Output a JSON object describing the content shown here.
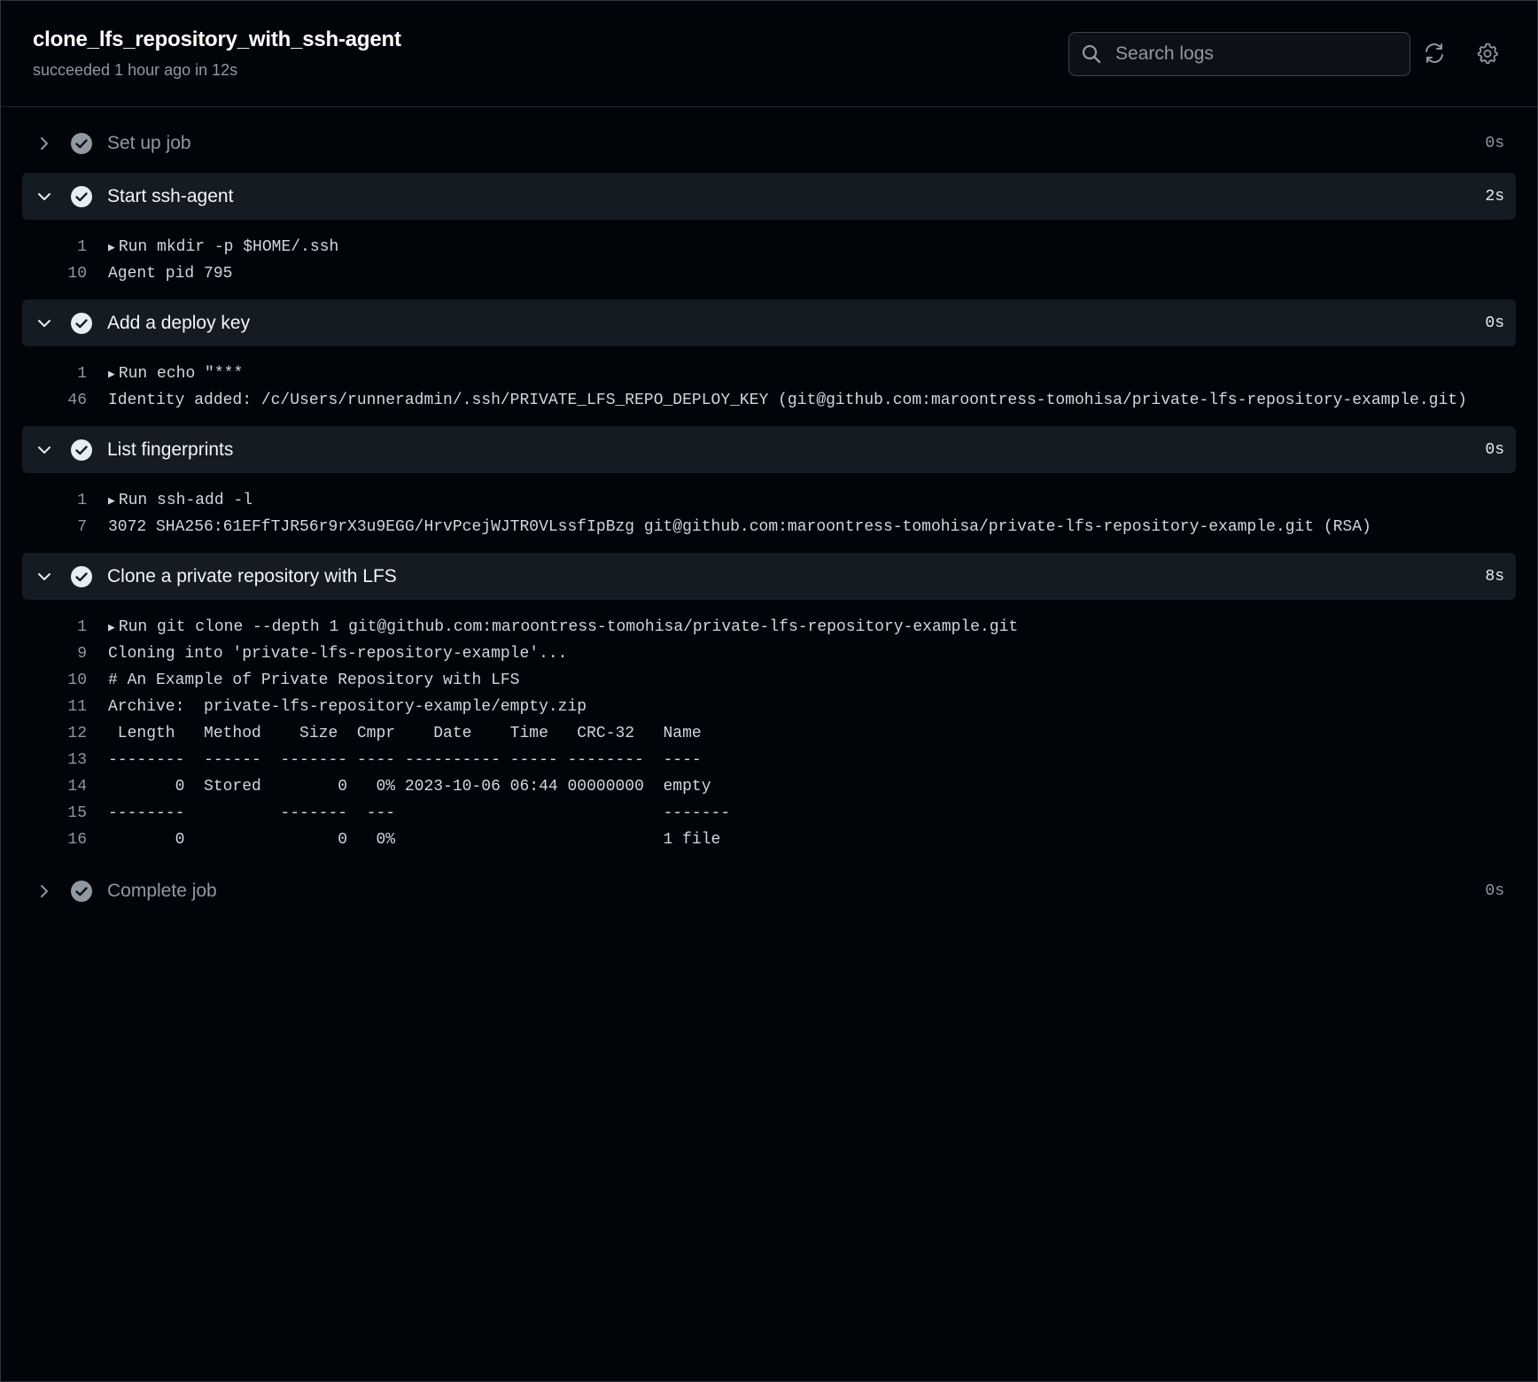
{
  "header": {
    "title": "clone_lfs_repository_with_ssh-agent",
    "status": "succeeded 1 hour ago in 12s",
    "search_placeholder": "Search logs",
    "refresh_icon": "sync-icon",
    "settings_icon": "gear-icon"
  },
  "colors": {
    "background": "#010409",
    "expanded_header": "#151b23",
    "muted_text": "#9198a1",
    "check_bg": "#9198a1"
  },
  "steps": [
    {
      "name": "Set up job",
      "duration": "0s",
      "expanded": false
    },
    {
      "name": "Start ssh-agent",
      "duration": "2s",
      "expanded": true,
      "lines": [
        {
          "num": "1",
          "text": "Run mkdir -p $HOME/.ssh",
          "collapsible": true
        },
        {
          "num": "10",
          "text": "Agent pid 795"
        }
      ]
    },
    {
      "name": "Add a deploy key",
      "duration": "0s",
      "expanded": true,
      "lines": [
        {
          "num": "1",
          "text": "Run echo \"***",
          "collapsible": true
        },
        {
          "num": "46",
          "text": "Identity added: /c/Users/runneradmin/.ssh/PRIVATE_LFS_REPO_DEPLOY_KEY (git@github.com:maroontress-tomohisa/private-lfs-repository-example.git)"
        }
      ]
    },
    {
      "name": "List fingerprints",
      "duration": "0s",
      "expanded": true,
      "lines": [
        {
          "num": "1",
          "text": "Run ssh-add -l",
          "collapsible": true
        },
        {
          "num": "7",
          "text": "3072 SHA256:61EFfTJR56r9rX3u9EGG/HrvPcejWJTR0VLssfIpBzg git@github.com:maroontress-tomohisa/private-lfs-repository-example.git (RSA)"
        }
      ]
    },
    {
      "name": "Clone a private repository with LFS",
      "duration": "8s",
      "expanded": true,
      "lines": [
        {
          "num": "1",
          "text": "Run git clone --depth 1 git@github.com:maroontress-tomohisa/private-lfs-repository-example.git",
          "collapsible": true
        },
        {
          "num": "9",
          "text": "Cloning into 'private-lfs-repository-example'..."
        },
        {
          "num": "10",
          "text": "# An Example of Private Repository with LFS"
        },
        {
          "num": "11",
          "text": "Archive:  private-lfs-repository-example/empty.zip"
        },
        {
          "num": "12",
          "text": " Length   Method    Size  Cmpr    Date    Time   CRC-32   Name"
        },
        {
          "num": "13",
          "text": "--------  ------  ------- ---- ---------- ----- --------  ----"
        },
        {
          "num": "14",
          "text": "       0  Stored        0   0% 2023-10-06 06:44 00000000  empty"
        },
        {
          "num": "15",
          "text": "--------          -------  ---                            -------"
        },
        {
          "num": "16",
          "text": "       0                0   0%                            1 file"
        }
      ]
    },
    {
      "name": "Complete job",
      "duration": "0s",
      "expanded": false
    }
  ]
}
